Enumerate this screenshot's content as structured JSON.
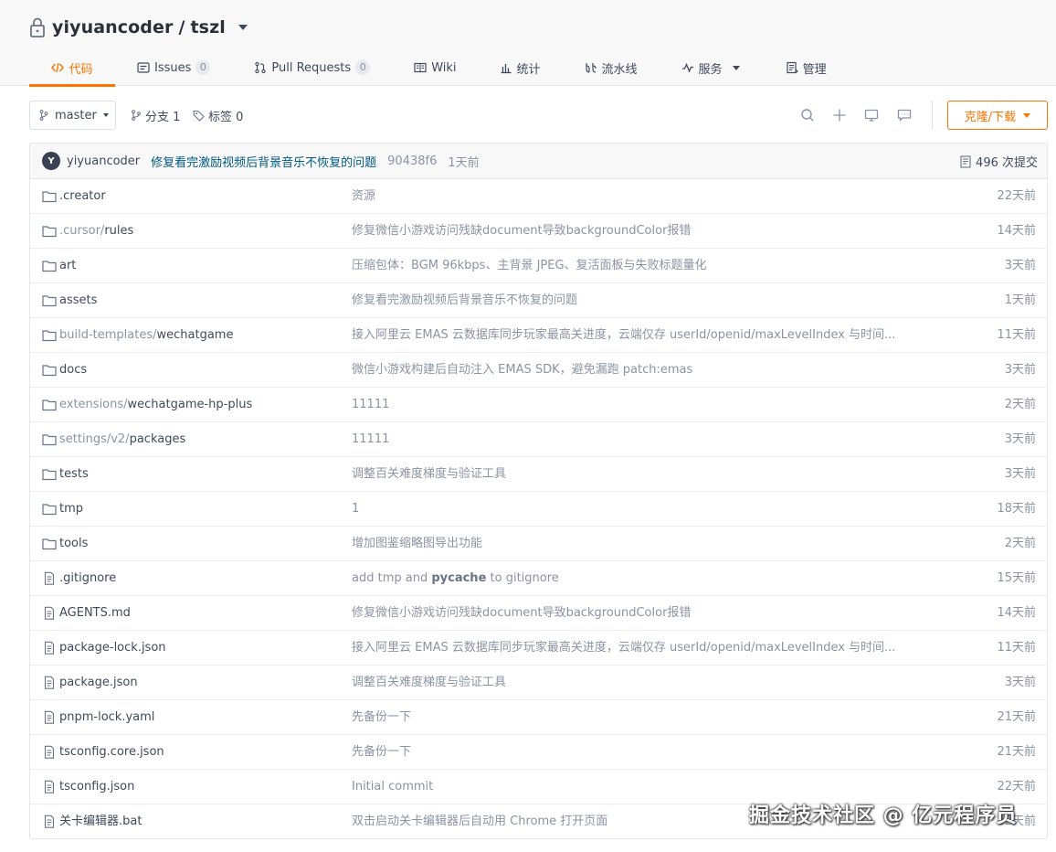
{
  "repo": {
    "owner": "yiyuancoder",
    "separator": " / ",
    "name": "tszl"
  },
  "tabs": [
    {
      "label": "代码",
      "icon": "code-icon",
      "active": true
    },
    {
      "label": "Issues",
      "icon": "issues-icon",
      "count": "0"
    },
    {
      "label": "Pull Requests",
      "icon": "pull-request-icon",
      "count": "0"
    },
    {
      "label": "Wiki",
      "icon": "wiki-icon"
    },
    {
      "label": "统计",
      "icon": "stats-icon"
    },
    {
      "label": "流水线",
      "icon": "pipeline-icon"
    },
    {
      "label": "服务",
      "icon": "service-icon",
      "dropdown": true
    },
    {
      "label": "管理",
      "icon": "manage-icon"
    }
  ],
  "toolbar": {
    "branch": "master",
    "branches_label": "分支 1",
    "tags_label": "标签 0",
    "clone_label": "克隆/下载"
  },
  "commit": {
    "avatar_letter": "Y",
    "author": "yiyuancoder",
    "message": "修复看完激励视频后背景音乐不恢复的问题",
    "sha": "90438f6",
    "time": "1天前",
    "count_label": "496 次提交"
  },
  "files": [
    {
      "type": "folder",
      "prefix": "",
      "name": ".creator",
      "message": "资源",
      "time": "22天前"
    },
    {
      "type": "folder",
      "prefix": ".cursor/",
      "name": "rules",
      "message": "修复微信小游戏访问残缺document导致backgroundColor报错",
      "time": "14天前"
    },
    {
      "type": "folder",
      "prefix": "",
      "name": "art",
      "message": "压缩包体：BGM 96kbps、主背景 JPEG、复活面板与失败标题量化",
      "time": "3天前"
    },
    {
      "type": "folder",
      "prefix": "",
      "name": "assets",
      "message": "修复看完激励视频后背景音乐不恢复的问题",
      "time": "1天前"
    },
    {
      "type": "folder",
      "prefix": "build-templates/",
      "name": "wechatgame",
      "message": "接入阿里云 EMAS 云数据库同步玩家最高关进度，云端仅存 userId/openid/maxLevelIndex 与时间...",
      "time": "11天前"
    },
    {
      "type": "folder",
      "prefix": "",
      "name": "docs",
      "message": "微信小游戏构建后自动注入 EMAS SDK，避免漏跑 patch:emas",
      "time": "3天前"
    },
    {
      "type": "folder",
      "prefix": "extensions/",
      "name": "wechatgame-hp-plus",
      "message": "11111",
      "time": "2天前"
    },
    {
      "type": "folder",
      "prefix": "settings/v2/",
      "name": "packages",
      "message": "11111",
      "time": "3天前"
    },
    {
      "type": "folder",
      "prefix": "",
      "name": "tests",
      "message": "调整百关难度梯度与验证工具",
      "time": "3天前"
    },
    {
      "type": "folder",
      "prefix": "",
      "name": "tmp",
      "message": "1",
      "time": "18天前"
    },
    {
      "type": "folder",
      "prefix": "",
      "name": "tools",
      "message": "增加图鉴缩略图导出功能",
      "time": "2天前"
    },
    {
      "type": "file",
      "prefix": "",
      "name": ".gitignore",
      "message_pre": "add tmp and ",
      "message_bold": "pycache",
      "message_post": " to gitignore",
      "time": "15天前"
    },
    {
      "type": "file",
      "prefix": "",
      "name": "AGENTS.md",
      "message": "修复微信小游戏访问残缺document导致backgroundColor报错",
      "time": "14天前"
    },
    {
      "type": "file",
      "prefix": "",
      "name": "package-lock.json",
      "message": "接入阿里云 EMAS 云数据库同步玩家最高关进度，云端仅存 userId/openid/maxLevelIndex 与时间...",
      "time": "11天前"
    },
    {
      "type": "file",
      "prefix": "",
      "name": "package.json",
      "message": "调整百关难度梯度与验证工具",
      "time": "3天前"
    },
    {
      "type": "file",
      "prefix": "",
      "name": "pnpm-lock.yaml",
      "message": "先备份一下",
      "time": "21天前"
    },
    {
      "type": "file",
      "prefix": "",
      "name": "tsconfig.core.json",
      "message": "先备份一下",
      "time": "21天前"
    },
    {
      "type": "file",
      "prefix": "",
      "name": "tsconfig.json",
      "message": "Initial commit",
      "time": "22天前"
    },
    {
      "type": "file",
      "prefix": "",
      "name": "关卡编辑器.bat",
      "message": "双击启动关卡编辑器后自动用 Chrome 打开页面",
      "time": "22天前"
    }
  ],
  "watermark": "掘金技术社区 @ 亿元程序员",
  "colors": {
    "accent": "#fe7300",
    "link": "#005980",
    "muted": "#8c92a4",
    "text": "#40485b"
  }
}
